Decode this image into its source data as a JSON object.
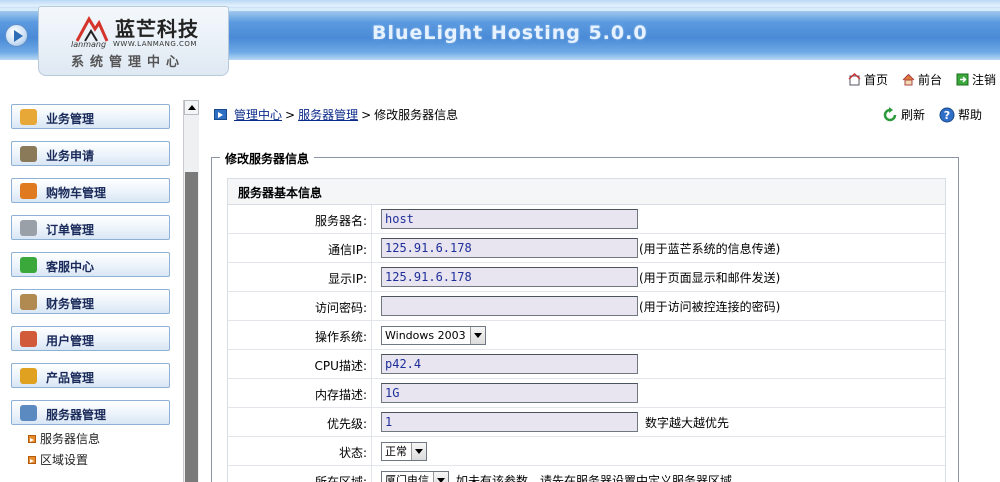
{
  "header": {
    "app_title": "BlueLight Hosting 5.0.0",
    "logo_name": "蓝芒科技",
    "logo_en_left": "lanmang",
    "logo_en_right": "WWW.LANMANG.COM",
    "logo_subtitle": "系统管理中心"
  },
  "top_links": [
    {
      "label": "首页",
      "icon": "home-page-icon"
    },
    {
      "label": "前台",
      "icon": "house-icon"
    },
    {
      "label": "注销",
      "icon": "logout-icon"
    }
  ],
  "sidebar": {
    "items": [
      {
        "label": "业务管理",
        "icon": "box-icon",
        "color": "#e8a838"
      },
      {
        "label": "业务申请",
        "icon": "pen-icon",
        "color": "#8a7a5a"
      },
      {
        "label": "购物车管理",
        "icon": "cart-icon",
        "color": "#e07a20"
      },
      {
        "label": "订单管理",
        "icon": "document-icon",
        "color": "#9aa0a8"
      },
      {
        "label": "客服中心",
        "icon": "check-icon",
        "color": "#3aa83a"
      },
      {
        "label": "财务管理",
        "icon": "wallet-icon",
        "color": "#b08a50"
      },
      {
        "label": "用户管理",
        "icon": "users-icon",
        "color": "#d05a3a"
      },
      {
        "label": "产品管理",
        "icon": "award-icon",
        "color": "#e0a020"
      },
      {
        "label": "服务器管理",
        "icon": "server-icon",
        "color": "#5a8ac0"
      }
    ],
    "sub_items": [
      {
        "label": "服务器信息"
      },
      {
        "label": "区域设置"
      }
    ]
  },
  "breadcrumb": {
    "root": "管理中心",
    "sep1": ">",
    "parent": "服务器管理",
    "sep2": ">",
    "current": "修改服务器信息"
  },
  "actions": {
    "refresh_label": "刷新",
    "help_label": "帮助"
  },
  "form": {
    "legend": "修改服务器信息",
    "section_title": "服务器基本信息",
    "server_name_label": "服务器名:",
    "server_name_value": "host",
    "comm_ip_label": "通信IP:",
    "comm_ip_value": "125.91.6.178",
    "comm_ip_hint": "(用于蓝芒系统的信息传递)",
    "display_ip_label": "显示IP:",
    "display_ip_value": "125.91.6.178",
    "display_ip_hint": "(用于页面显示和邮件发送)",
    "password_label": "访问密码:",
    "password_value": "",
    "password_hint": "(用于访问被控连接的密码)",
    "os_label": "操作系统:",
    "os_value": "Windows 2003",
    "cpu_label": "CPU描述:",
    "cpu_value": "p42.4",
    "mem_label": "内存描述:",
    "mem_value": "1G",
    "priority_label": "优先级:",
    "priority_value": "1",
    "priority_hint": "数字越大越优先",
    "status_label": "状态:",
    "status_value": "正常",
    "region_label": "所在区域:",
    "region_value": "厦门电信",
    "region_hint": "如未有该参数，请先在服务器设置中定义服务器区域"
  }
}
